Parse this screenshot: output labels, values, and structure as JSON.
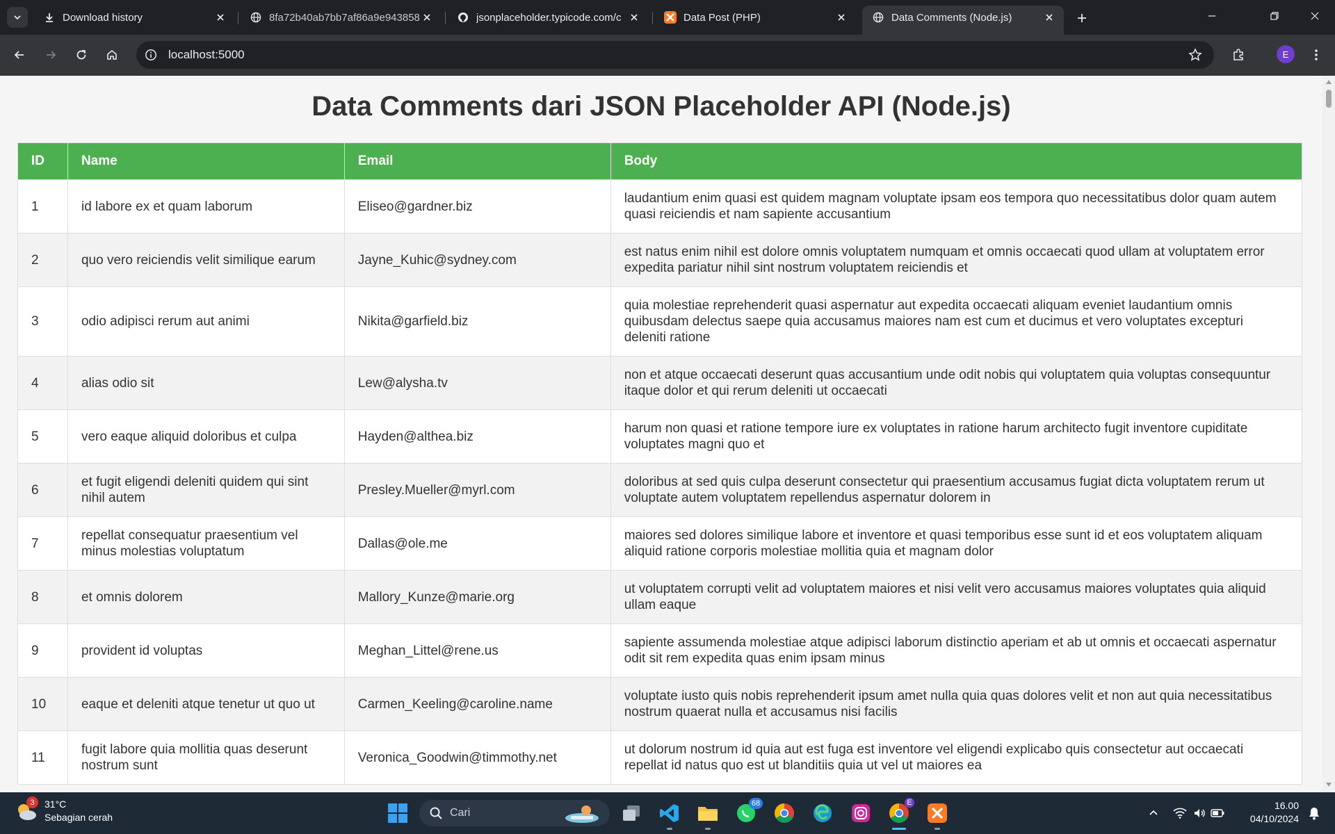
{
  "browser": {
    "tabs": [
      {
        "title": "Download history",
        "icon": "download-icon",
        "active": false
      },
      {
        "title": "8fa72b40ab7bb7af86a9e943858",
        "icon": "globe-icon",
        "active": false
      },
      {
        "title": "jsonplaceholder.typicode.com/c",
        "icon": "github-icon",
        "active": false
      },
      {
        "title": "Data Post (PHP)",
        "icon": "xampp-icon",
        "active": false
      },
      {
        "title": "Data Comments (Node.js)",
        "icon": "globe-icon",
        "active": true
      }
    ],
    "url": "localhost:5000",
    "profile_initial": "E"
  },
  "page": {
    "title": "Data Comments dari JSON Placeholder API (Node.js)",
    "columns": [
      "ID",
      "Name",
      "Email",
      "Body"
    ],
    "rows": [
      {
        "id": "1",
        "name": "id labore ex et quam laborum",
        "email": "Eliseo@gardner.biz",
        "body": "laudantium enim quasi est quidem magnam voluptate ipsam eos tempora quo necessitatibus dolor quam autem quasi reiciendis et nam sapiente accusantium"
      },
      {
        "id": "2",
        "name": "quo vero reiciendis velit similique earum",
        "email": "Jayne_Kuhic@sydney.com",
        "body": "est natus enim nihil est dolore omnis voluptatem numquam et omnis occaecati quod ullam at voluptatem error expedita pariatur nihil sint nostrum voluptatem reiciendis et"
      },
      {
        "id": "3",
        "name": "odio adipisci rerum aut animi",
        "email": "Nikita@garfield.biz",
        "body": "quia molestiae reprehenderit quasi aspernatur aut expedita occaecati aliquam eveniet laudantium omnis quibusdam delectus saepe quia accusamus maiores nam est cum et ducimus et vero voluptates excepturi deleniti ratione"
      },
      {
        "id": "4",
        "name": "alias odio sit",
        "email": "Lew@alysha.tv",
        "body": "non et atque occaecati deserunt quas accusantium unde odit nobis qui voluptatem quia voluptas consequuntur itaque dolor et qui rerum deleniti ut occaecati"
      },
      {
        "id": "5",
        "name": "vero eaque aliquid doloribus et culpa",
        "email": "Hayden@althea.biz",
        "body": "harum non quasi et ratione tempore iure ex voluptates in ratione harum architecto fugit inventore cupiditate voluptates magni quo et"
      },
      {
        "id": "6",
        "name": "et fugit eligendi deleniti quidem qui sint nihil autem",
        "email": "Presley.Mueller@myrl.com",
        "body": "doloribus at sed quis culpa deserunt consectetur qui praesentium accusamus fugiat dicta voluptatem rerum ut voluptate autem voluptatem repellendus aspernatur dolorem in"
      },
      {
        "id": "7",
        "name": "repellat consequatur praesentium vel minus molestias voluptatum",
        "email": "Dallas@ole.me",
        "body": "maiores sed dolores similique labore et inventore et quasi temporibus esse sunt id et eos voluptatem aliquam aliquid ratione corporis molestiae mollitia quia et magnam dolor"
      },
      {
        "id": "8",
        "name": "et omnis dolorem",
        "email": "Mallory_Kunze@marie.org",
        "body": "ut voluptatem corrupti velit ad voluptatem maiores et nisi velit vero accusamus maiores voluptates quia aliquid ullam eaque"
      },
      {
        "id": "9",
        "name": "provident id voluptas",
        "email": "Meghan_Littel@rene.us",
        "body": "sapiente assumenda molestiae atque adipisci laborum distinctio aperiam et ab ut omnis et occaecati aspernatur odit sit rem expedita quas enim ipsam minus"
      },
      {
        "id": "10",
        "name": "eaque et deleniti atque tenetur ut quo ut",
        "email": "Carmen_Keeling@caroline.name",
        "body": "voluptate iusto quis nobis reprehenderit ipsum amet nulla quia quas dolores velit et non aut quia necessitatibus nostrum quaerat nulla et accusamus nisi facilis"
      },
      {
        "id": "11",
        "name": "fugit labore quia mollitia quas deserunt nostrum sunt",
        "email": "Veronica_Goodwin@timmothy.net",
        "body": "ut dolorum nostrum id quia aut est fuga est inventore vel eligendi explicabo quis consectetur aut occaecati repellat id natus quo est ut blanditiis quia ut vel ut maiores ea"
      }
    ]
  },
  "taskbar": {
    "weather_badge": "3",
    "temperature": "31°C",
    "weather_desc": "Sebagian cerah",
    "search_label": "Cari",
    "whatsapp_badge": "68",
    "profile_badge": "E",
    "time": "16.00",
    "date": "04/10/2024"
  },
  "colors": {
    "header_green": "#4caf50",
    "tabstrip": "#202124",
    "toolbar": "#35363a",
    "taskbar": "#1f2a37"
  }
}
